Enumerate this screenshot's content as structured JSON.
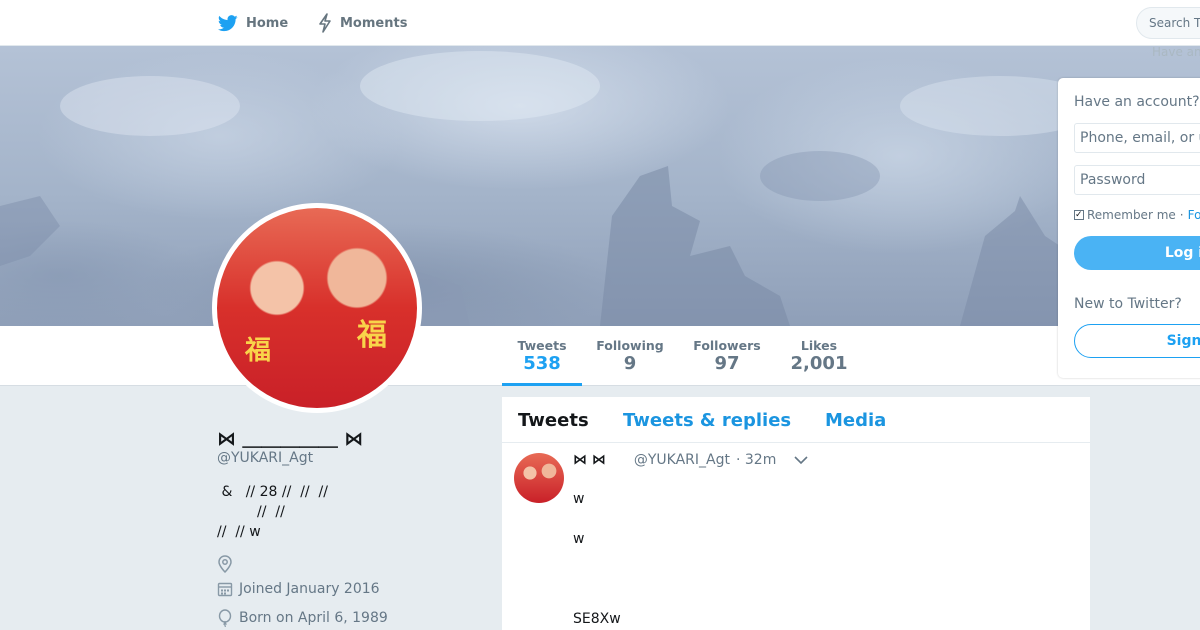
{
  "nav": {
    "home_label": "Home",
    "moments_label": "Moments",
    "search_placeholder": "Search T",
    "have_account_hint": "Have an"
  },
  "icons": {
    "home": "twitter-bird-icon",
    "moments": "lightning-icon",
    "location": "location-pin-icon",
    "joined": "calendar-icon",
    "born": "balloon-icon",
    "caret": "chevron-down-icon"
  },
  "colors": {
    "accent": "#1da1f2",
    "link": "#1b95e0",
    "muted": "#657786",
    "background": "#e6ecf0"
  },
  "stats": [
    {
      "label": "Tweets",
      "value": "538"
    },
    {
      "label": "Following",
      "value": "9"
    },
    {
      "label": "Followers",
      "value": "97"
    },
    {
      "label": "Likes",
      "value": "2,001"
    }
  ],
  "avatar": {
    "mark_left": "福",
    "mark_right": "福"
  },
  "profile": {
    "name": "⋈ ＿＿＿＿＿ ⋈",
    "handle": "@YUKARI_Agt",
    "bio": " &   // 28 //  //  //\n         //  //\n//  // w",
    "joined": "Joined January 2016",
    "born": "Born on April 6, 1989"
  },
  "timeline": {
    "tabs": [
      "Tweets",
      "Tweets & replies",
      "Media"
    ],
    "tweet": {
      "name": "⋈  ⋈",
      "handle": "@YUKARI_Agt",
      "time": "· 32m",
      "lines": [
        "w",
        "w",
        "SE8Xw"
      ]
    }
  },
  "login": {
    "question": "Have an account?",
    "username_placeholder": "Phone, email, or u",
    "password_placeholder": "Password",
    "remember_label": "Remember me",
    "separator": "·",
    "forgot_label": "Fo",
    "login_button": "Log i",
    "new_question": "New to Twitter?",
    "signup_button": "Sign"
  }
}
